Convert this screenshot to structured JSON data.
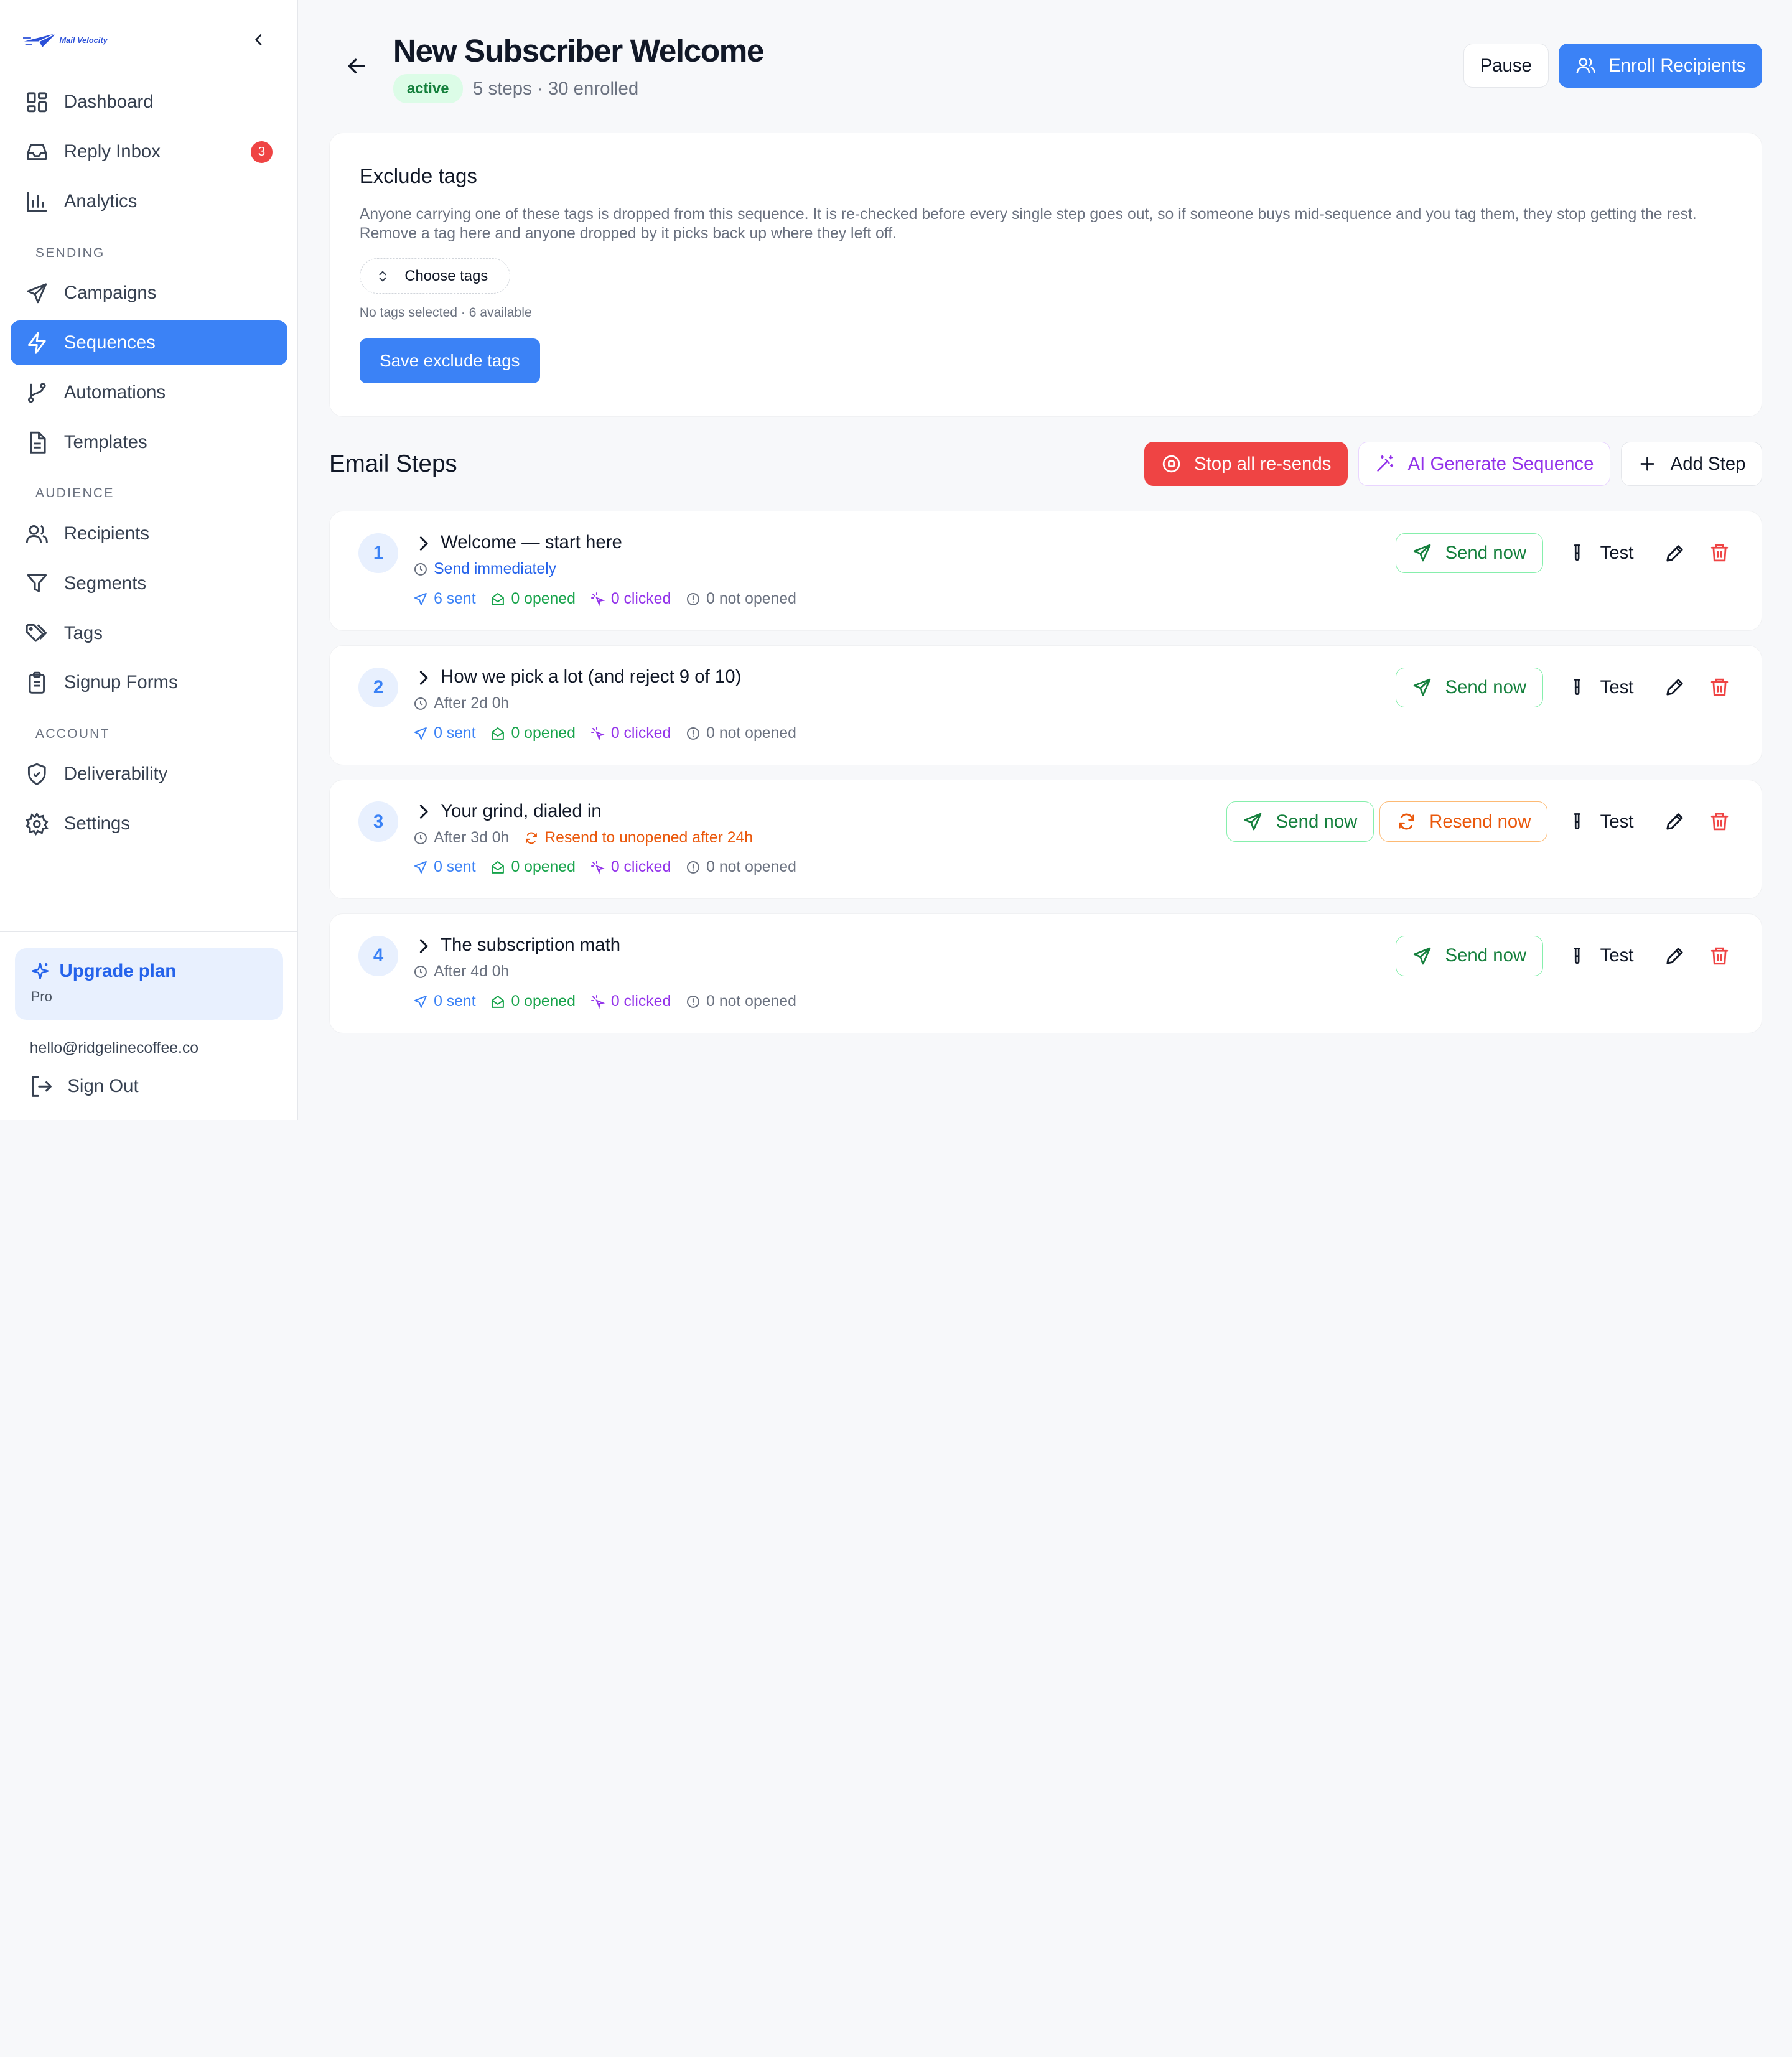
{
  "brand": {
    "logo_text": "Mail Velocity"
  },
  "sidebar": {
    "items_main": [
      {
        "label": "Dashboard",
        "icon": "dashboard-icon"
      },
      {
        "label": "Reply Inbox",
        "icon": "inbox-icon",
        "badge": "3"
      },
      {
        "label": "Analytics",
        "icon": "analytics-icon"
      }
    ],
    "section_sending": "SENDING",
    "items_sending": [
      {
        "label": "Campaigns",
        "icon": "send-icon"
      },
      {
        "label": "Sequences",
        "icon": "bolt-icon",
        "active": true
      },
      {
        "label": "Automations",
        "icon": "branch-icon"
      },
      {
        "label": "Templates",
        "icon": "file-icon"
      }
    ],
    "section_audience": "AUDIENCE",
    "items_audience": [
      {
        "label": "Recipients",
        "icon": "users-icon"
      },
      {
        "label": "Segments",
        "icon": "filter-icon"
      },
      {
        "label": "Tags",
        "icon": "tags-icon"
      },
      {
        "label": "Signup Forms",
        "icon": "clipboard-icon"
      }
    ],
    "section_account": "ACCOUNT",
    "items_account": [
      {
        "label": "Deliverability",
        "icon": "shield-icon"
      },
      {
        "label": "Settings",
        "icon": "gear-icon"
      }
    ],
    "upgrade": {
      "title": "Upgrade plan",
      "plan": "Pro"
    },
    "email": "hello@ridgelinecoffee.co",
    "signout": "Sign Out"
  },
  "header": {
    "title": "New Subscriber Welcome",
    "status": "active",
    "meta": "5 steps · 30 enrolled",
    "pause_label": "Pause",
    "enroll_label": "Enroll Recipients"
  },
  "exclude": {
    "title": "Exclude tags",
    "description": "Anyone carrying one of these tags is dropped from this sequence. It is re-checked before every single step goes out, so if someone buys mid-sequence and you tag them, they stop getting the rest. Remove a tag here and anyone dropped by it picks back up where they left off.",
    "choose_label": "Choose tags",
    "hint": "No tags selected · 6 available",
    "save_label": "Save exclude tags"
  },
  "steps_section": {
    "title": "Email Steps",
    "stop_label": "Stop all re-sends",
    "ai_label": "AI Generate Sequence",
    "add_label": "Add Step"
  },
  "steps": [
    {
      "num": "1",
      "title": "Welcome — start here",
      "delay": "Send immediately",
      "resend_note": "",
      "sent": "6 sent",
      "opened": "0 opened",
      "clicked": "0 clicked",
      "not_opened": "0 not opened",
      "send_label": "Send now",
      "resend_label": "",
      "test_label": "Test"
    },
    {
      "num": "2",
      "title": "How we pick a lot (and reject 9 of 10)",
      "delay": "After 2d 0h",
      "resend_note": "",
      "sent": "0 sent",
      "opened": "0 opened",
      "clicked": "0 clicked",
      "not_opened": "0 not opened",
      "send_label": "Send now",
      "resend_label": "",
      "test_label": "Test"
    },
    {
      "num": "3",
      "title": "Your grind, dialed in",
      "delay": "After 3d 0h",
      "resend_note": "Resend to unopened after 24h",
      "sent": "0 sent",
      "opened": "0 opened",
      "clicked": "0 clicked",
      "not_opened": "0 not opened",
      "send_label": "Send now",
      "resend_label": "Resend now",
      "test_label": "Test"
    },
    {
      "num": "4",
      "title": "The subscription math",
      "delay": "After 4d 0h",
      "resend_note": "",
      "sent": "0 sent",
      "opened": "0 opened",
      "clicked": "0 clicked",
      "not_opened": "0 not opened",
      "send_label": "Send now",
      "resend_label": "",
      "test_label": "Test"
    }
  ]
}
